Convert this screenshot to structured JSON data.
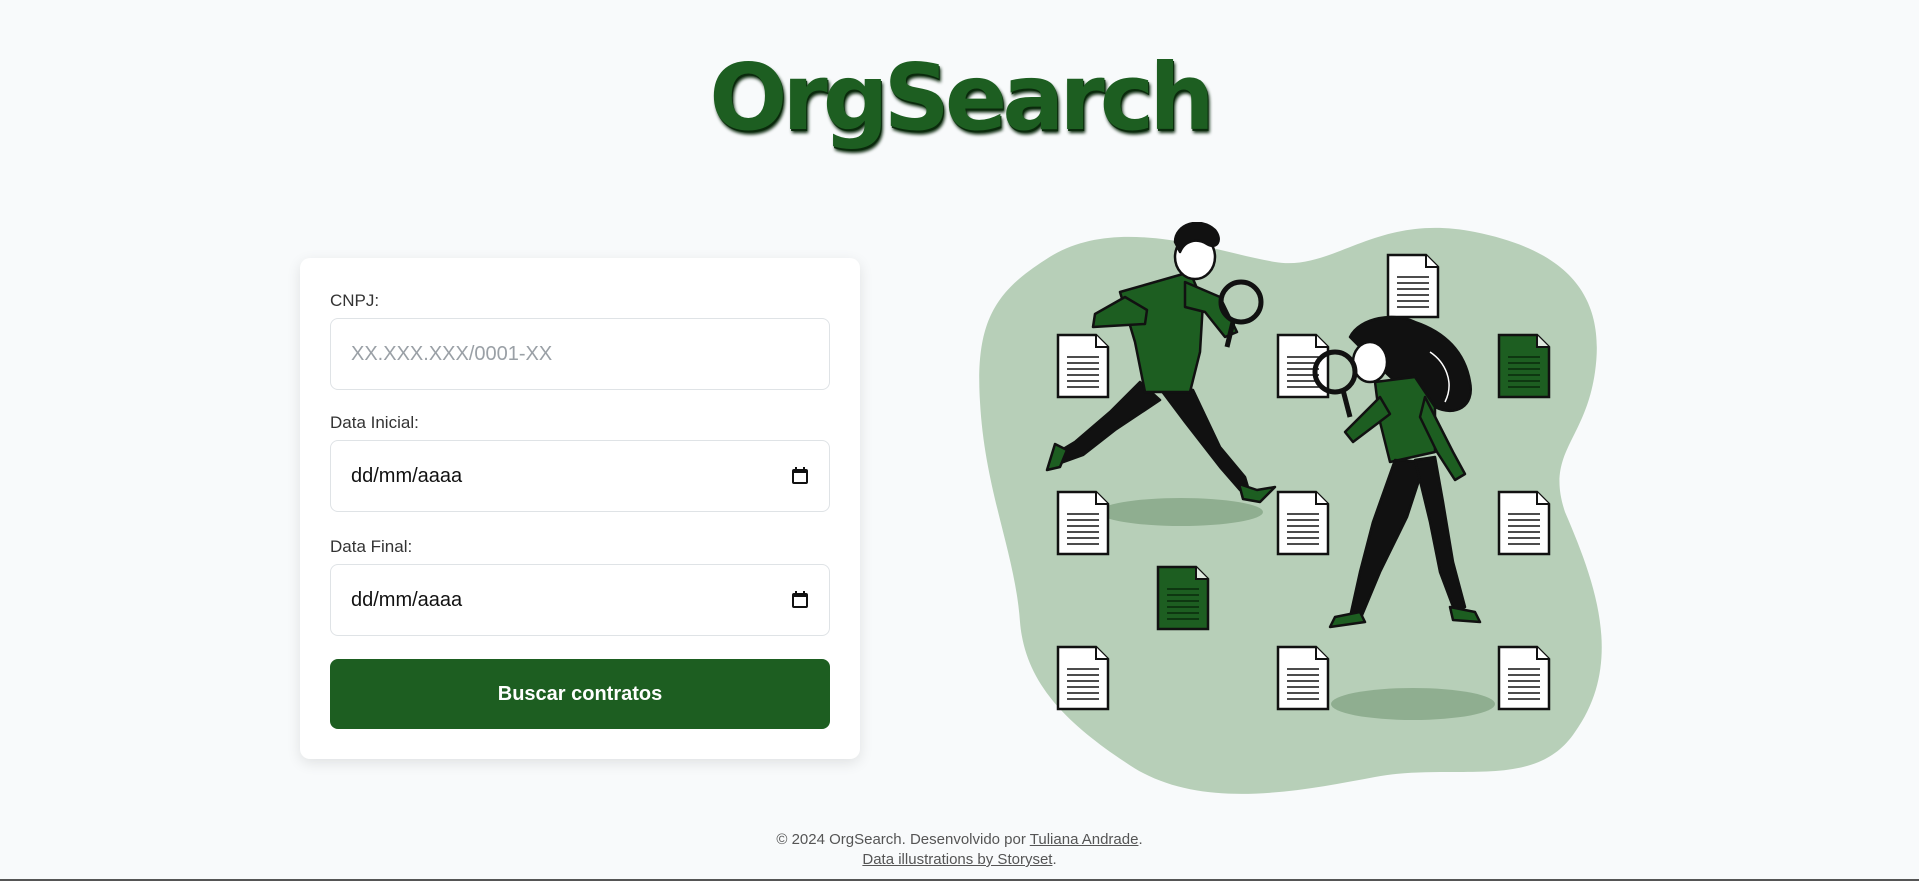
{
  "logo": {
    "text": "OrgSearch"
  },
  "form": {
    "cnpj": {
      "label": "CNPJ:",
      "placeholder": "XX.XXX.XXX/0001-XX"
    },
    "start_date": {
      "label": "Data Inicial:",
      "value": "dd/mm/aaaa"
    },
    "end_date": {
      "label": "Data Final:",
      "value": "dd/mm/aaaa"
    },
    "submit_label": "Buscar contratos"
  },
  "footer": {
    "line1_prefix": "© 2024 OrgSearch. Desenvolvido por ",
    "author_link": "Tuliana Andrade",
    "line1_suffix": ".",
    "credit_link": "Data illustrations by Storyset",
    "line2_suffix": "."
  },
  "colors": {
    "brand_green": "#1d5e21",
    "blob_green": "#b7cfb8",
    "background": "#f8fafb"
  },
  "illustration": {
    "icon": "detectives-searching-documents-illustration"
  }
}
